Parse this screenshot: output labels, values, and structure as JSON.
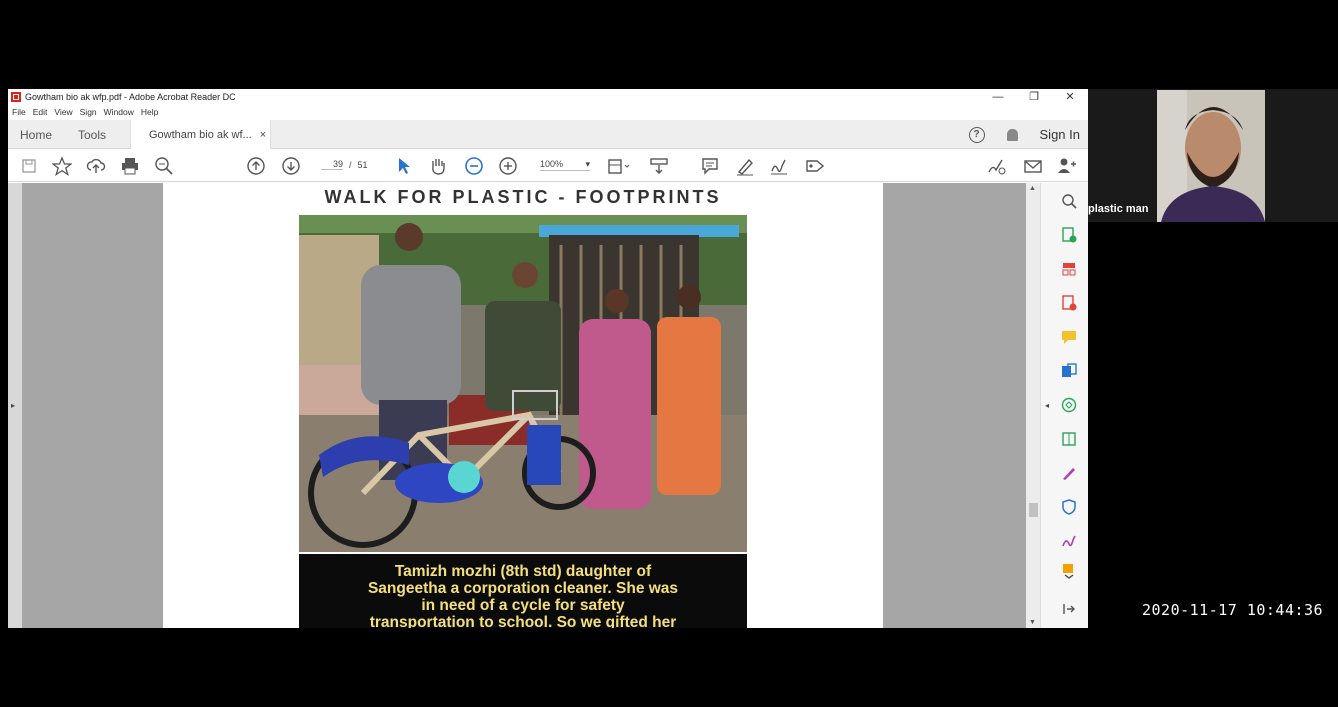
{
  "window": {
    "title": "Gowtham bio ak wfp.pdf - Adobe Acrobat Reader DC",
    "controls": {
      "minimize": "—",
      "restore": "❐",
      "close": "✕"
    }
  },
  "menu": [
    "File",
    "Edit",
    "View",
    "Sign",
    "Window",
    "Help"
  ],
  "tabs": {
    "home": "Home",
    "tools": "Tools",
    "doc": "Gowtham bio ak wf...",
    "doc_close": "×"
  },
  "header_right": {
    "help": "?",
    "sign_in": "Sign In"
  },
  "toolbar": {
    "page_current": "39",
    "page_sep": "/",
    "page_total": "51",
    "zoom": "100%",
    "zoom_caret": "▾"
  },
  "document": {
    "heading": "WALK FOR PLASTIC - FOOTPRINTS",
    "caption_lines": [
      "Tamizh mozhi (8th std) daughter of",
      "Sangeetha a corporation cleaner. She was",
      "in need of a cycle for safety",
      "transportation to school. So we gifted her"
    ]
  },
  "video": {
    "participant_name": "plastic man"
  },
  "timestamp": "2020-11-17 10:44:36",
  "colors": {
    "acrobat_red": "#d9241c",
    "accent_blue": "#2a73cc",
    "caption_text": "#f4e07a"
  }
}
